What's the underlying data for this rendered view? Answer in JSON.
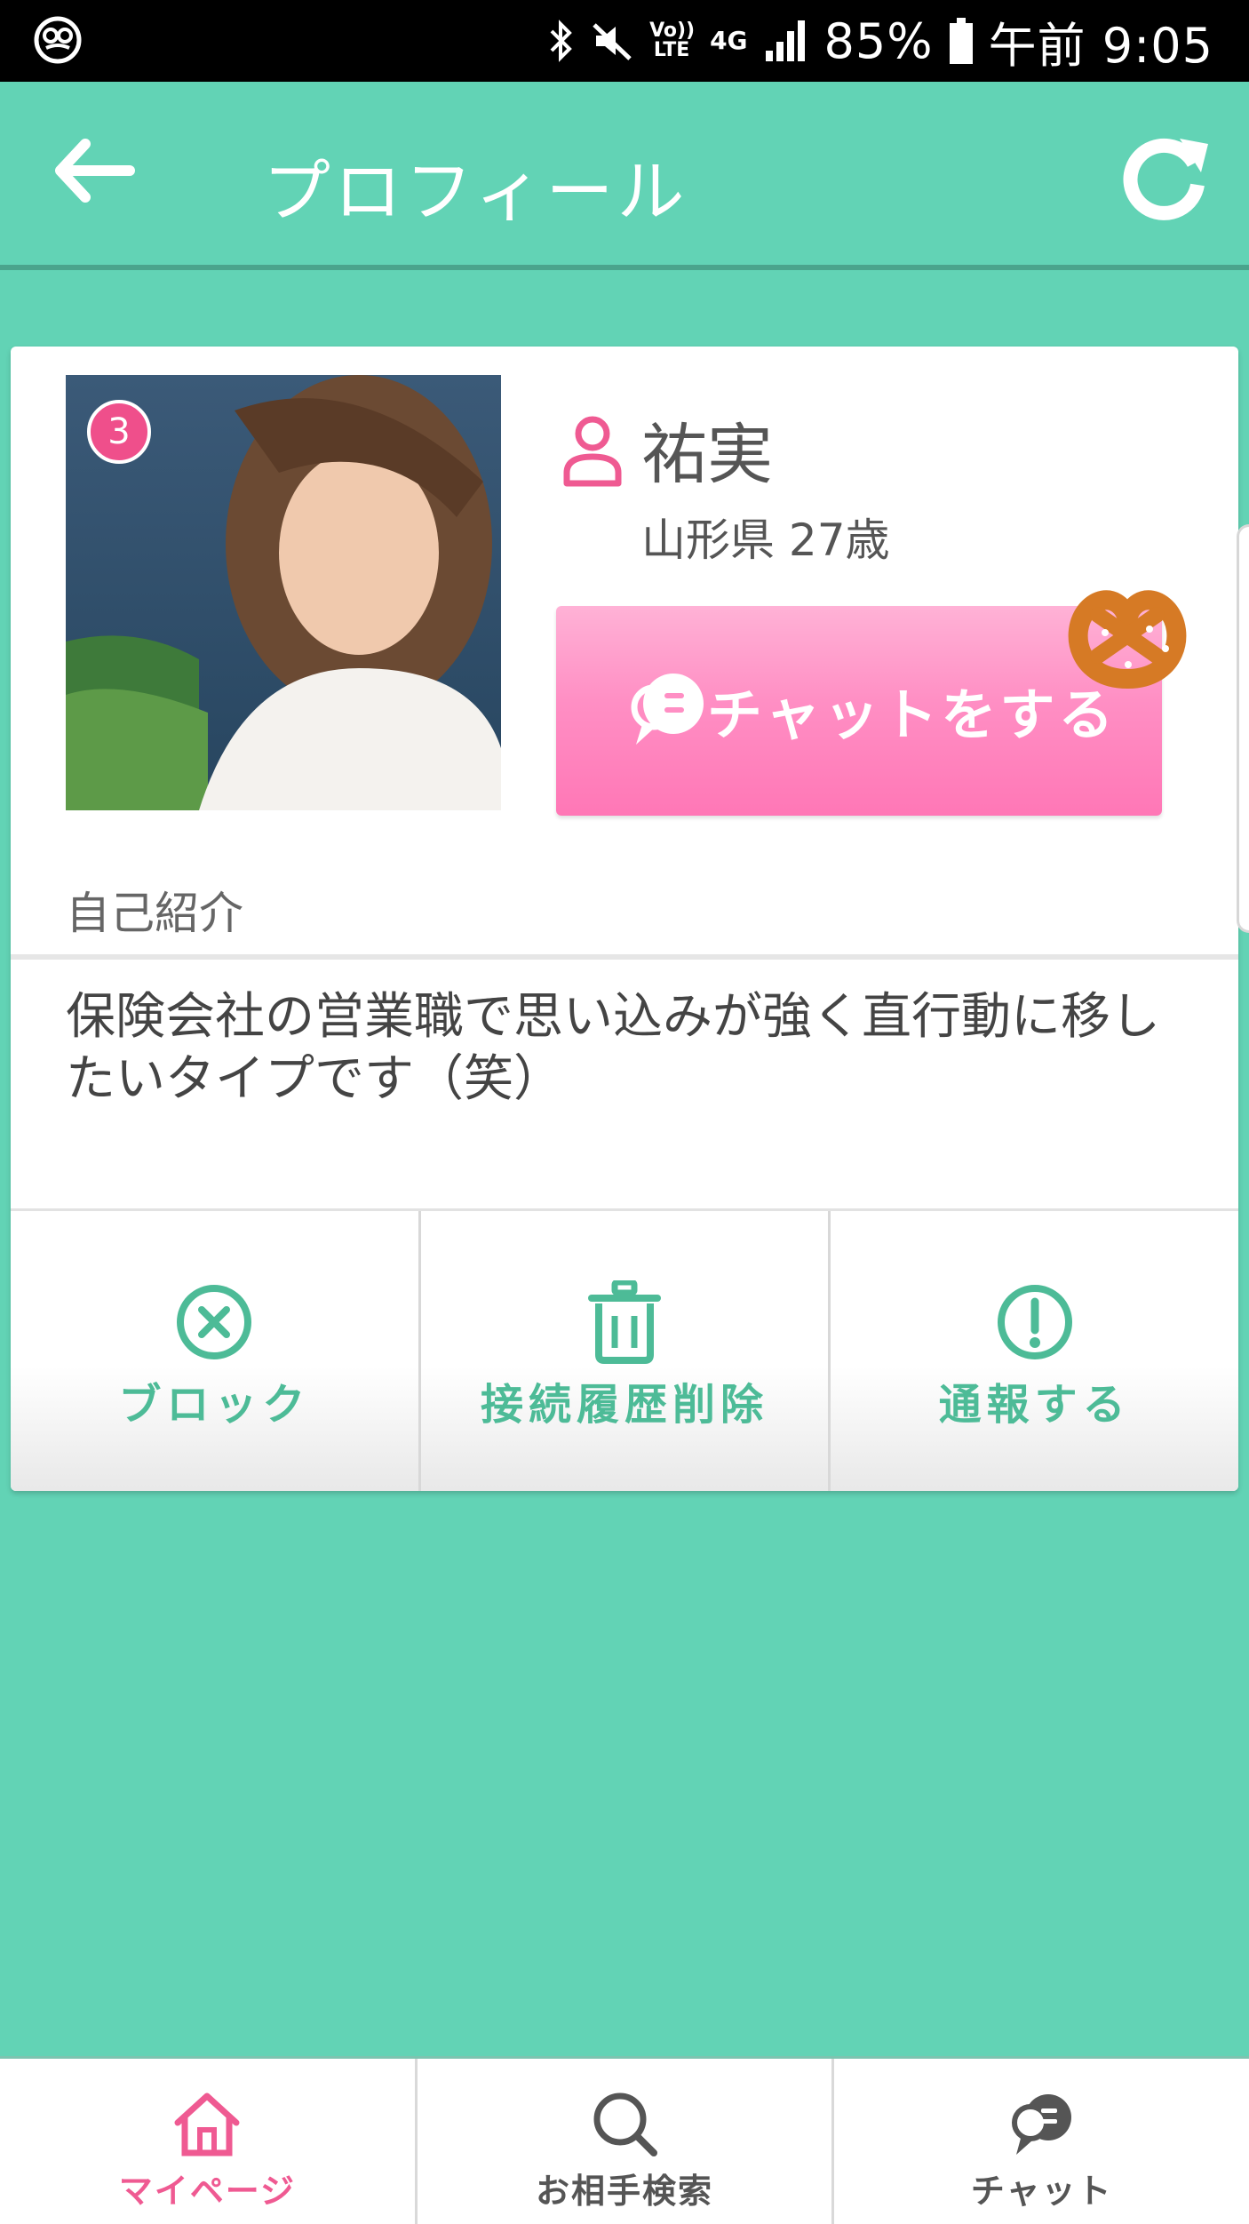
{
  "status_bar": {
    "battery": "85%",
    "time": "午前 9:05",
    "network_label": "Vo)) LTE",
    "network_type": "4G",
    "icons": [
      "pretzel-app-icon",
      "bluetooth-icon",
      "mute-icon",
      "lte-icon",
      "signal-icon",
      "battery-icon"
    ]
  },
  "header": {
    "title": "プロフィール",
    "back_icon": "back-arrow-icon",
    "refresh_icon": "refresh-icon"
  },
  "profile": {
    "badge_count": "3",
    "name": "祐実",
    "location_age": "山形県 27歳",
    "chat_button_label": "チャットをする",
    "intro_label": "自己紹介",
    "intro_text": "保険会社の営業職で思い込みが強く直行動に移したいタイプです（笑）"
  },
  "actions": [
    {
      "label": "ブロック",
      "icon": "block-x-icon"
    },
    {
      "label": "接続履歴削除",
      "icon": "trash-icon"
    },
    {
      "label": "通報する",
      "icon": "exclamation-icon"
    }
  ],
  "bottom_nav": [
    {
      "label": "マイページ",
      "icon": "home-icon",
      "active": true
    },
    {
      "label": "お相手検索",
      "icon": "search-icon",
      "active": false
    },
    {
      "label": "チャット",
      "icon": "chat-bubble-icon",
      "active": false
    }
  ],
  "colors": {
    "background": "#62d3b5",
    "accent_pink": "#ef5a92",
    "chat_button": "#ff8fc4",
    "action_green": "#4dbb97"
  }
}
